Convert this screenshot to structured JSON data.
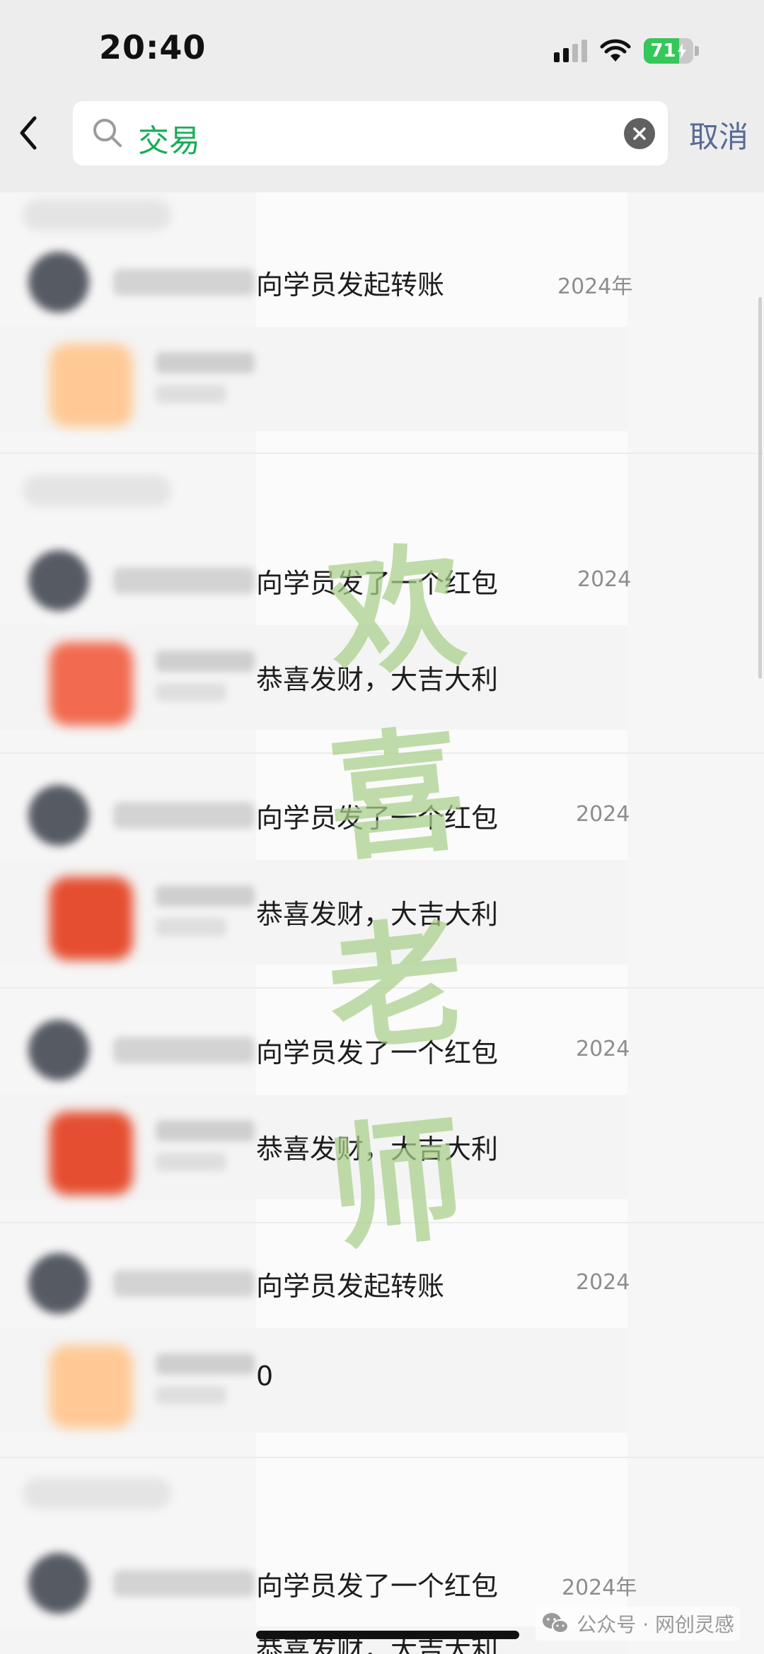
{
  "status_bar": {
    "time": "20:40",
    "battery_percent": "71",
    "battery_level": 0.71,
    "battery_color": "#34c759",
    "signal_icon": "cellular-signal-icon",
    "wifi_icon": "wifi-icon",
    "charging_icon": "bolt-icon"
  },
  "search": {
    "back_icon": "chevron-left-icon",
    "query": "交易",
    "search_icon": "search-icon",
    "clear_icon": "clear-circle-icon",
    "cancel_label": "取消",
    "query_color": "#1aad5a",
    "cancel_color": "#576b95"
  },
  "results": [
    {
      "title": "向学员发起转账",
      "date": "2024年",
      "message": ""
    },
    {
      "title": "向学员发了一个红包",
      "date": "2024",
      "message": "恭喜发财，大吉大利"
    },
    {
      "title": "向学员发了一个红包",
      "date": "2024",
      "message": "恭喜发财，大吉大利"
    },
    {
      "title": "向学员发了一个红包",
      "date": "2024",
      "message": "恭喜发财，大吉大利"
    },
    {
      "title": "向学员发起转账",
      "date": "2024",
      "message": "0"
    },
    {
      "title": "向学员发了一个红包",
      "date": "2024年",
      "message": "恭喜发财，大吉大利"
    }
  ],
  "watermark": {
    "chars": [
      "欢",
      "喜",
      "老",
      "师"
    ],
    "color": "#a8d08a"
  },
  "footer": {
    "icon": "wechat-icon",
    "text": "公众号 · 网创灵感"
  }
}
